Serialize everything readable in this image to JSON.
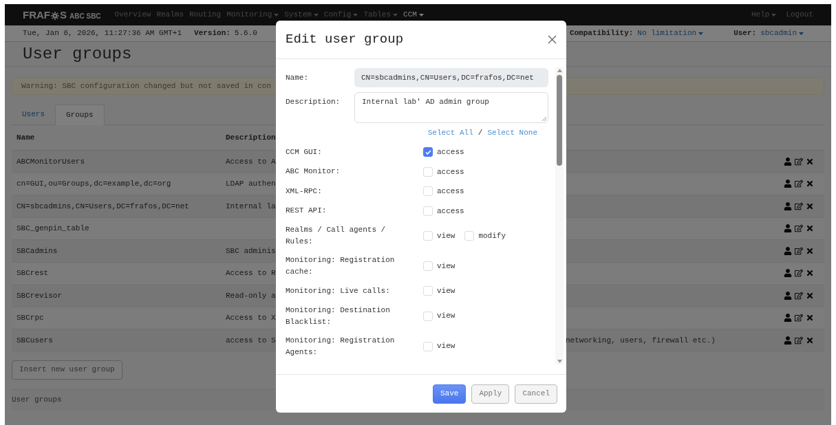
{
  "navbar": {
    "logo": {
      "left": "FRAF",
      "right": "S",
      "suffix": "ABC SBC"
    },
    "menu": [
      {
        "label": "Overview",
        "dropdown": false,
        "selected": false
      },
      {
        "label": "Realms",
        "dropdown": false,
        "selected": false
      },
      {
        "label": "Routing",
        "dropdown": false,
        "selected": false
      },
      {
        "label": "Monitoring",
        "dropdown": true,
        "selected": false
      },
      {
        "label": "System",
        "dropdown": true,
        "selected": false
      },
      {
        "label": "Config",
        "dropdown": true,
        "selected": false
      },
      {
        "label": "Tables",
        "dropdown": true,
        "selected": false
      },
      {
        "label": "CCM",
        "dropdown": true,
        "selected": true
      }
    ],
    "right_menu": [
      {
        "label": "Help",
        "dropdown": true
      },
      {
        "label": "Logout",
        "dropdown": false
      }
    ]
  },
  "info_bar": {
    "datetime": "Tue, Jan 6, 2026, 11:27:36 AM GMT+1",
    "version_label": "Version:",
    "version": "5.6.0",
    "compatibility_label": "Compatibility:",
    "compatibility": "No limitation",
    "user_label": "User:",
    "user": "sbcadmin"
  },
  "page_title": "User groups",
  "warning": "Warning: SBC configuration changed but not saved in con",
  "tabs": [
    {
      "label": "Users",
      "selected": false
    },
    {
      "label": "Groups",
      "selected": true
    }
  ],
  "table": {
    "columns": [
      "Name",
      "Description"
    ],
    "rows": [
      {
        "name": "ABCMonitorUsers",
        "description": "Access to A"
      },
      {
        "name": "cn=GUI,ou=Groups,dc=example,dc=org",
        "description": "LDAP authen"
      },
      {
        "name": "CN=sbcadmins,CN=Users,DC=frafos,DC=net",
        "description": "Internal la"
      },
      {
        "name": "SBC_genpin_table"
      },
      {
        "name": "SBCadmins",
        "description": "SBC adminis"
      },
      {
        "name": "SBCrest",
        "description": "Access to R"
      },
      {
        "name": "SBCrevisor",
        "description": "Read-only a"
      },
      {
        "name": "SBCrpc",
        "description": "Access to X"
      },
      {
        "name": "SBCusers",
        "description": "access to S",
        "description_tail": "networking, users, firewall etc.)"
      }
    ]
  },
  "insert_button": "Insert new user group",
  "footer": "User groups",
  "dialog": {
    "title": "Edit user group",
    "name_label": "Name:",
    "name_value": "CN=sbcadmins,CN=Users,DC=frafos,DC=net",
    "description_label": "Description:",
    "description_value": "Internal lab' AD admin group",
    "select_all": "Select All",
    "separator": "/",
    "select_none": "Select None",
    "permissions": [
      {
        "label": "CCM GUI:",
        "options": [
          {
            "label": "access",
            "checked": true
          }
        ]
      },
      {
        "label": "ABC Monitor:",
        "options": [
          {
            "label": "access",
            "checked": false
          }
        ]
      },
      {
        "label": "XML-RPC:",
        "options": [
          {
            "label": "access",
            "checked": false
          }
        ]
      },
      {
        "label": "REST API:",
        "options": [
          {
            "label": "access",
            "checked": false
          }
        ]
      },
      {
        "label": "Realms / Call agents / Rules:",
        "options": [
          {
            "label": "view",
            "checked": false
          },
          {
            "label": "modify",
            "checked": false
          }
        ]
      },
      {
        "label": "Monitoring: Registration cache:",
        "options": [
          {
            "label": "view",
            "checked": false
          }
        ]
      },
      {
        "label": "Monitoring: Live calls:",
        "options": [
          {
            "label": "view",
            "checked": false
          }
        ]
      },
      {
        "label": "Monitoring: Destination Blacklist:",
        "options": [
          {
            "label": "view",
            "checked": false
          }
        ]
      },
      {
        "label": "Monitoring: Registration Agents:",
        "options": [
          {
            "label": "view",
            "checked": false
          }
        ]
      }
    ],
    "buttons": [
      {
        "label": "Save",
        "kind": "primary"
      },
      {
        "label": "Apply",
        "kind": "secondary"
      },
      {
        "label": "Cancel",
        "kind": "secondary"
      }
    ]
  }
}
